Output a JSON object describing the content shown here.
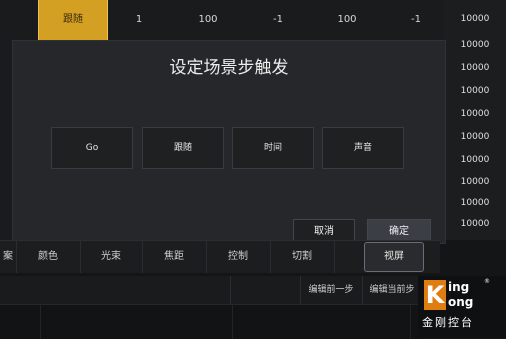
{
  "table_row": {
    "cells": [
      "跟随",
      "1",
      "100",
      "-1",
      "100",
      "-1",
      "10000"
    ]
  },
  "right_column": [
    "10000",
    "10000",
    "10000",
    "10000",
    "10000",
    "10000",
    "10000",
    "10000",
    "10000",
    "10000",
    "10000"
  ],
  "dialog": {
    "title": "设定场景步触发",
    "options": [
      "Go",
      "跟随",
      "时间",
      "声音"
    ],
    "cancel_label": "取消",
    "confirm_label": "确定"
  },
  "tabs": [
    "案",
    "颜色",
    "光束",
    "焦距",
    "控制",
    "切割",
    "视屏"
  ],
  "active_tab": "视屏",
  "bottom_actions": [
    "编辑前一步",
    "编辑当前步"
  ],
  "logo": {
    "k": "K",
    "ing": "ing",
    "ong": "ong",
    "reg": "®",
    "chinese": "金刚控台"
  },
  "colors": {
    "highlight": "#d4a024",
    "logo_orange": "#e07d10"
  }
}
